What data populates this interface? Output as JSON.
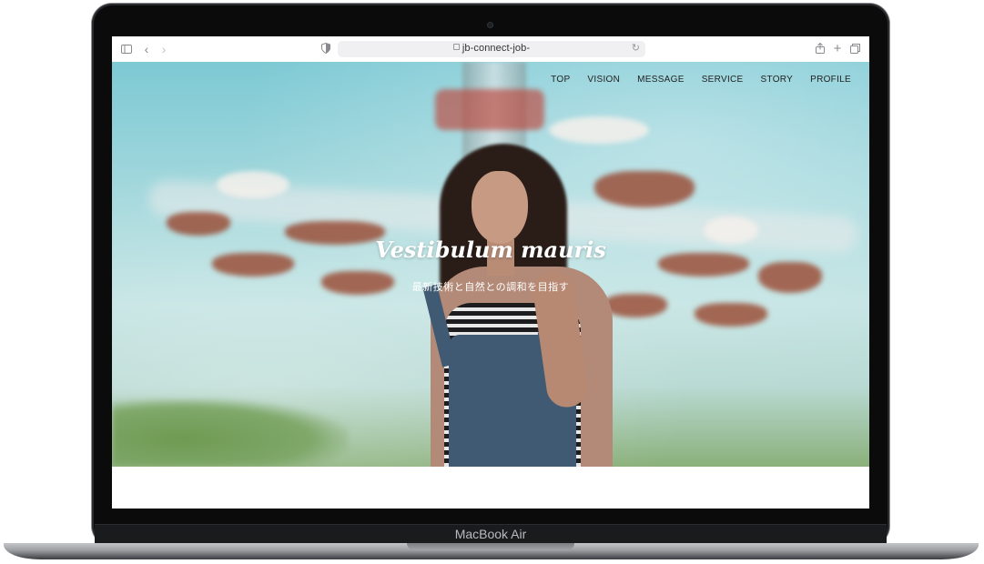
{
  "browser": {
    "url": "jb-connect-job-",
    "icons": [
      "sidebar-icon",
      "back-icon",
      "forward-icon",
      "shield-icon",
      "lock-icon",
      "reload-icon",
      "share-icon",
      "new-tab-icon",
      "tabs-icon"
    ]
  },
  "site": {
    "nav": [
      "TOP",
      "VISION",
      "MESSAGE",
      "SERVICE",
      "STORY",
      "PROFILE"
    ],
    "hero_title": "Vestibulum mauris",
    "hero_subtitle": "最新技術と自然との調和を目指す"
  },
  "device": {
    "label": "MacBook Air"
  },
  "colors": {
    "sky": "#a6d9dd",
    "nav_text": "#222222",
    "hero_text": "#ffffff",
    "bezel": "#0b0b0c"
  }
}
